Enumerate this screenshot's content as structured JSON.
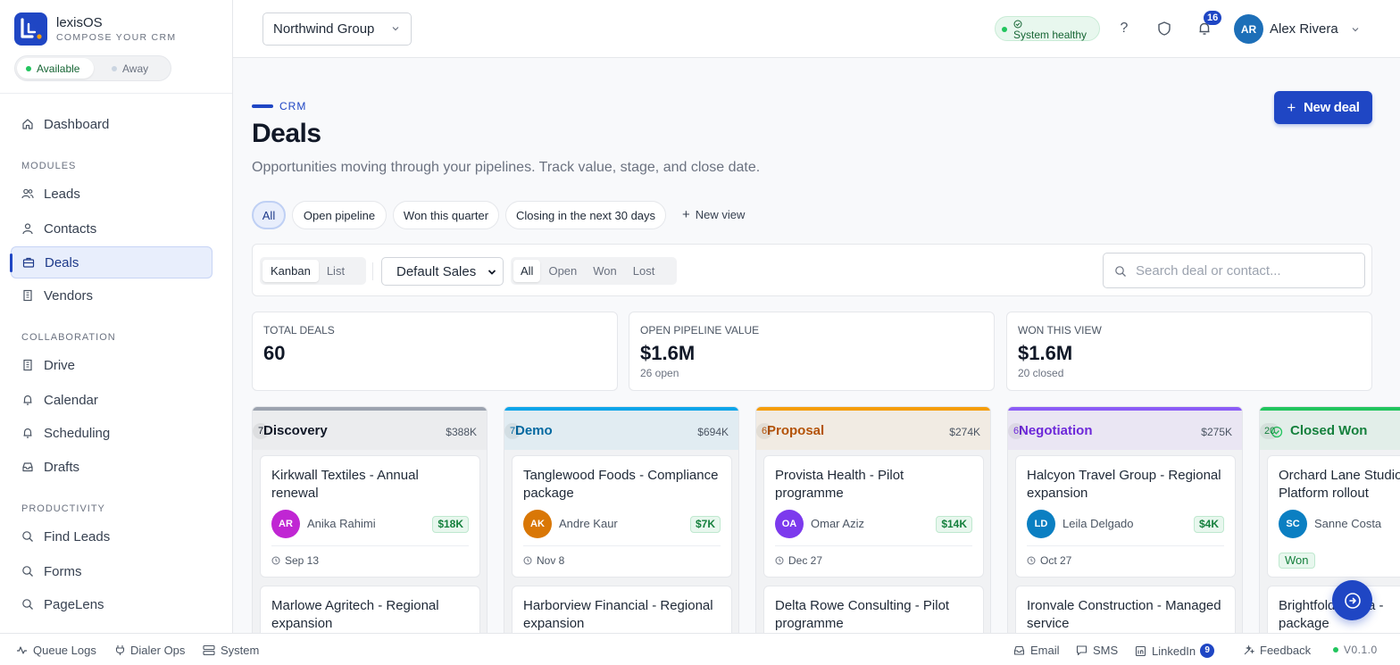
{
  "brand": {
    "name": "lexisOS",
    "tagline": "COMPOSE YOUR CRM",
    "logo_letter": "L"
  },
  "presence": {
    "available": "Available",
    "away": "Away"
  },
  "sidebar": {
    "dashboard": "Dashboard",
    "modules_label": "MODULES",
    "modules": [
      "Leads",
      "Contacts",
      "Deals",
      "Vendors"
    ],
    "collaboration_label": "COLLABORATION",
    "collaboration": [
      "Drive",
      "Calendar",
      "Scheduling",
      "Drafts"
    ],
    "productivity_label": "PRODUCTIVITY",
    "productivity": [
      "Find Leads",
      "Forms",
      "PageLens"
    ]
  },
  "header": {
    "org": "Northwind Group",
    "health": "System healthy",
    "help": "?",
    "notifications": "16",
    "user_initials": "AR",
    "user_name": "Alex Rivera"
  },
  "page": {
    "crumb": "CRM",
    "title": "Deals",
    "subtitle": "Opportunities moving through your pipelines. Track value, stage, and close date.",
    "new_deal": "New deal"
  },
  "views": {
    "items": [
      "All",
      "Open pipeline",
      "Won this quarter",
      "Closing in the next 30 days"
    ],
    "new_view": "New view"
  },
  "toolbar": {
    "layout": [
      "Kanban",
      "List"
    ],
    "pipeline": "Default Sales",
    "status": [
      "All",
      "Open",
      "Won",
      "Lost"
    ],
    "search_placeholder": "Search deal or contact..."
  },
  "stats": [
    {
      "label": "TOTAL DEALS",
      "value": "60",
      "sub": ""
    },
    {
      "label": "OPEN PIPELINE VALUE",
      "value": "$1.6M",
      "sub": "26 open"
    },
    {
      "label": "WON THIS VIEW",
      "value": "$1.6M",
      "sub": "20 closed"
    }
  ],
  "columns": [
    {
      "title": "Discovery",
      "count": "7",
      "total": "$388K",
      "color": "#9ca3af",
      "title_color": "#111827",
      "cards": [
        {
          "title": "Kirkwall Textiles - Annual renewal",
          "initials": "AR",
          "owner": "Anika Rahimi",
          "amount": "$18K",
          "date": "Sep 13",
          "avatar_color": "#c026d3"
        },
        {
          "title": "Marlowe Agritech - Regional expansion"
        }
      ]
    },
    {
      "title": "Demo",
      "count": "7",
      "total": "$694K",
      "color": "#0ea5e9",
      "title_color": "#0369a1",
      "cards": [
        {
          "title": "Tanglewood Foods - Compliance package",
          "initials": "AK",
          "owner": "Andre Kaur",
          "amount": "$7K",
          "date": "Nov 8",
          "avatar_color": "#d97706"
        },
        {
          "title": "Harborview Financial - Regional expansion"
        }
      ]
    },
    {
      "title": "Proposal",
      "count": "6",
      "total": "$274K",
      "color": "#f59e0b",
      "title_color": "#b45309",
      "cards": [
        {
          "title": "Provista Health - Pilot programme",
          "initials": "OA",
          "owner": "Omar Aziz",
          "amount": "$14K",
          "date": "Dec 27",
          "avatar_color": "#7c3aed"
        },
        {
          "title": "Delta Rowe Consulting - Pilot programme"
        }
      ]
    },
    {
      "title": "Negotiation",
      "count": "6",
      "total": "$275K",
      "color": "#8b5cf6",
      "title_color": "#6d28d9",
      "cards": [
        {
          "title": "Halcyon Travel Group - Regional expansion",
          "initials": "LD",
          "owner": "Leila Delgado",
          "amount": "$4K",
          "date": "Oct 27",
          "avatar_color": "#0b7fc2"
        },
        {
          "title": "Ironvale Construction - Managed service"
        }
      ]
    },
    {
      "title": "Closed Won",
      "count": "20",
      "total": "",
      "color": "#22c55e",
      "title_color": "#15803d",
      "cards": [
        {
          "title": "Orchard Lane Studio - Platform rollout",
          "initials": "SC",
          "owner": "Sanne Costa",
          "badge": "Won",
          "avatar_color": "#0b7fc2"
        },
        {
          "title": "Brightfold Media - package"
        }
      ]
    }
  ],
  "footer": {
    "left": [
      "Queue Logs",
      "Dialer Ops",
      "System"
    ],
    "email": "Email",
    "sms": "SMS",
    "linkedin": "LinkedIn",
    "linkedin_count": "9",
    "feedback": "Feedback",
    "version": "V0.1.0"
  }
}
